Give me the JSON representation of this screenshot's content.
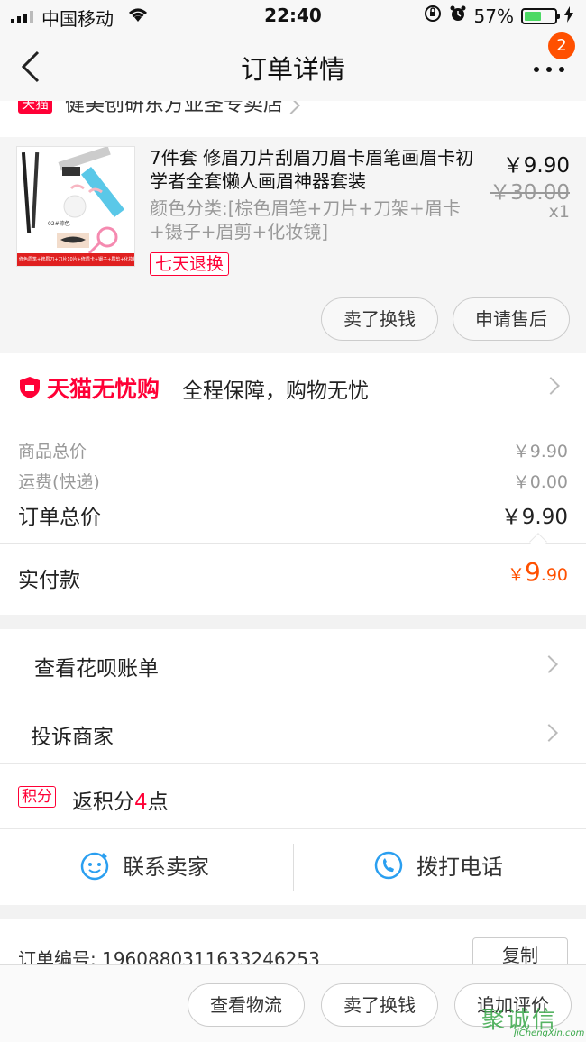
{
  "status_bar": {
    "carrier": "中国移动",
    "time": "22:40",
    "battery": "57%",
    "battery_level": 0.57
  },
  "nav": {
    "title": "订单详情",
    "badge_count": "2"
  },
  "store": {
    "tag": "天猫",
    "name": "健美创研东方亚圣专卖店"
  },
  "product": {
    "title": "7件套 修眉刀片刮眉刀眉卡眉笔画眉卡初学者全套懒人画眉神器套装",
    "sku": "颜色分类:[棕色眉笔+刀片+刀架+眉卡+镊子+眉剪+化妆镜]",
    "tag": "七天退换",
    "price": "￥9.90",
    "original_price": "￥30.00",
    "quantity": "x1",
    "thumb_caption": "修色眉笔+修眉刀+刀片10片+修眉卡+镊子+眉剪+化妆镜",
    "thumb_label": "02#棕色",
    "buttons": {
      "sell": "卖了换钱",
      "after_sale": "申请售后"
    }
  },
  "guarantee": {
    "logo_text": "天猫无忧购",
    "text": "全程保障，购物无忧"
  },
  "prices": {
    "goods_label": "商品总价",
    "goods_value": "￥9.90",
    "shipping_label": "运费(快递)",
    "shipping_value": "￥0.00",
    "total_label": "订单总价",
    "total_value": "￥9.90",
    "paid_label": "实付款",
    "paid_currency": "￥",
    "paid_int": "9",
    "paid_dec": ".90"
  },
  "menu": {
    "huabei": "查看花呗账单",
    "complain": "投诉商家",
    "points_tag": "积分",
    "points_prefix": "返积分",
    "points_num": "4",
    "points_suffix": "点"
  },
  "contact": {
    "seller": "联系卖家",
    "phone": "拨打电话"
  },
  "order": {
    "number_label": "订单编号:",
    "number": "1960880311633246253",
    "copy": "复制"
  },
  "bottom": {
    "logistics": "查看物流",
    "sell": "卖了换钱",
    "review": "追加评价"
  },
  "watermark": {
    "cn": "聚诚信",
    "en": "JiChengXin.com"
  },
  "colors": {
    "tmall_red": "#ff0036",
    "price_orange": "#ff5000",
    "link_blue": "#2b9ff0"
  }
}
